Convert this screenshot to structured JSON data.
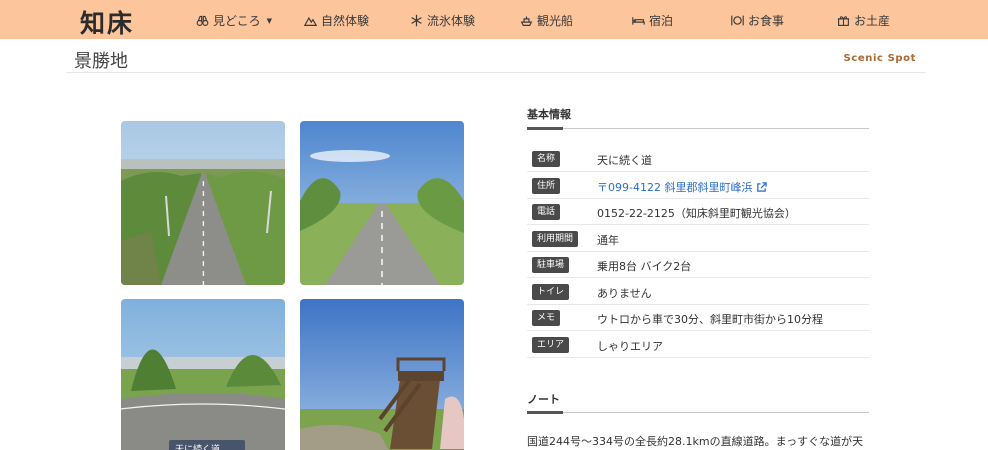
{
  "header": {
    "logo": "知床",
    "nav": [
      {
        "label": "見どころ",
        "icon": "binoculars-icon",
        "has_dropdown": true
      },
      {
        "label": "自然体験",
        "icon": "mountain-icon"
      },
      {
        "label": "流氷体験",
        "icon": "snowflake-icon"
      },
      {
        "label": "観光船",
        "icon": "ship-icon"
      },
      {
        "label": "宿泊",
        "icon": "bed-icon"
      },
      {
        "label": "お食事",
        "icon": "dining-icon"
      },
      {
        "label": "お土産",
        "icon": "gift-icon"
      }
    ]
  },
  "page": {
    "title": "景勝地",
    "subtitle": "Scenic Spot"
  },
  "gallery": {
    "photos": [
      {
        "name": "photo-road-1"
      },
      {
        "name": "photo-road-2"
      },
      {
        "name": "photo-road-3",
        "caption": "天に続く道"
      },
      {
        "name": "photo-observation-deck"
      }
    ]
  },
  "basic_info": {
    "heading": "基本情報",
    "rows": [
      {
        "label": "名称",
        "value": "天に続く道"
      },
      {
        "label": "住所",
        "value": "〒099-4122 斜里郡斜里町峰浜",
        "link": true
      },
      {
        "label": "電話",
        "value": "0152-22-2125（知床斜里町観光協会）"
      },
      {
        "label": "利用期間",
        "value": "通年"
      },
      {
        "label": "駐車場",
        "value": "乗用8台 バイク2台"
      },
      {
        "label": "トイレ",
        "value": "ありません"
      },
      {
        "label": "メモ",
        "value": "ウトロから車で30分、斜里町市街から10分程"
      },
      {
        "label": "エリア",
        "value": "しゃりエリア"
      }
    ]
  },
  "note": {
    "heading": "ノート",
    "text": "国道244号〜334号の全長約28.1kmの直線道路。まっすぐな道が天"
  },
  "colors": {
    "header_bg": "#fdc59b",
    "accent_text": "#a86a34",
    "label_bg": "#4a4a4a",
    "link": "#2a6fcc"
  }
}
